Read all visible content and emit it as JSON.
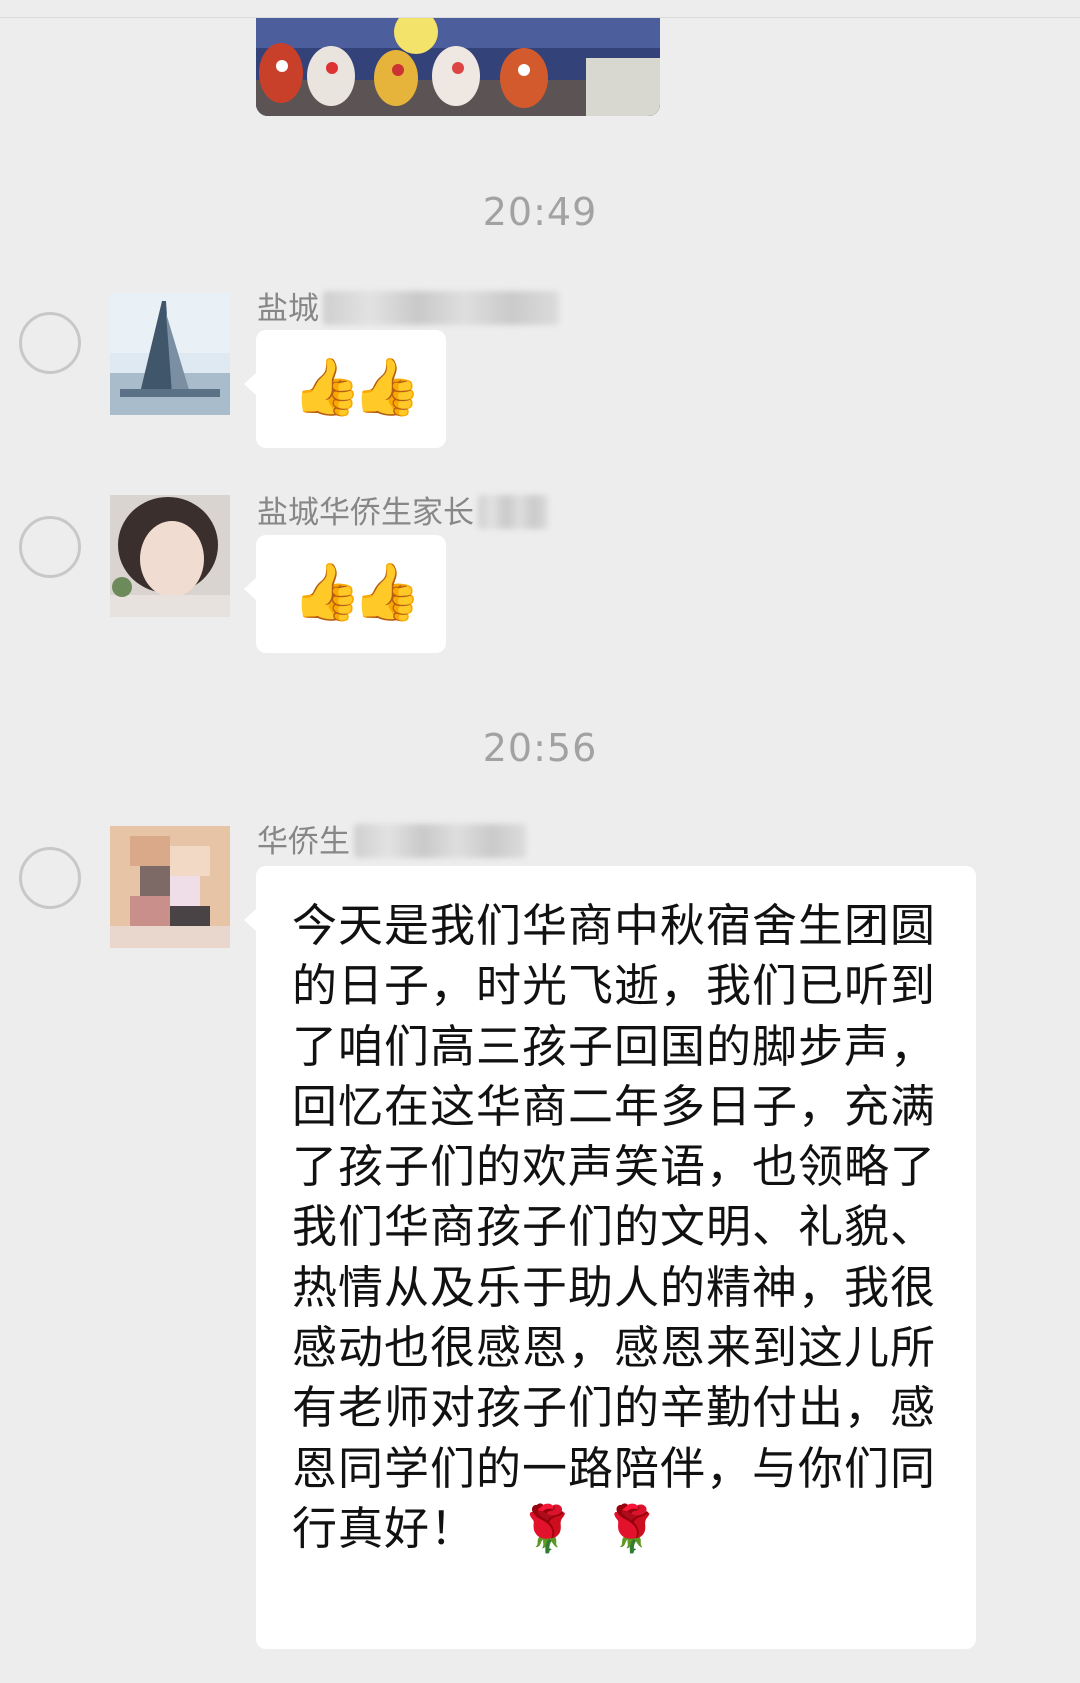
{
  "chat": {
    "timestamps": [
      "20:49",
      "20:56"
    ],
    "messages": [
      {
        "sender": "盐城",
        "emoji": [
          "👍",
          "👍"
        ]
      },
      {
        "sender": "盐城华侨生家长",
        "emoji": [
          "👍",
          "👍"
        ]
      },
      {
        "sender": "华侨生",
        "text": "今天是我们华商中秋宿舍生团圆的日子，时光飞逝，我们已听到了咱们高三孩子回国的脚步声，回忆在这华商二年多日子，充满了孩子们的欢声笑语，也领略了我们华商孩子们的文明、礼貌、热情从及乐于助人的精神，我很感动也很感恩，感恩来到这儿所有老师对孩子们的辛勤付出，感恩同学们的一路陪伴，与你们同行真好！",
        "trailing_emoji": [
          "🌹",
          "🌹"
        ]
      }
    ]
  }
}
